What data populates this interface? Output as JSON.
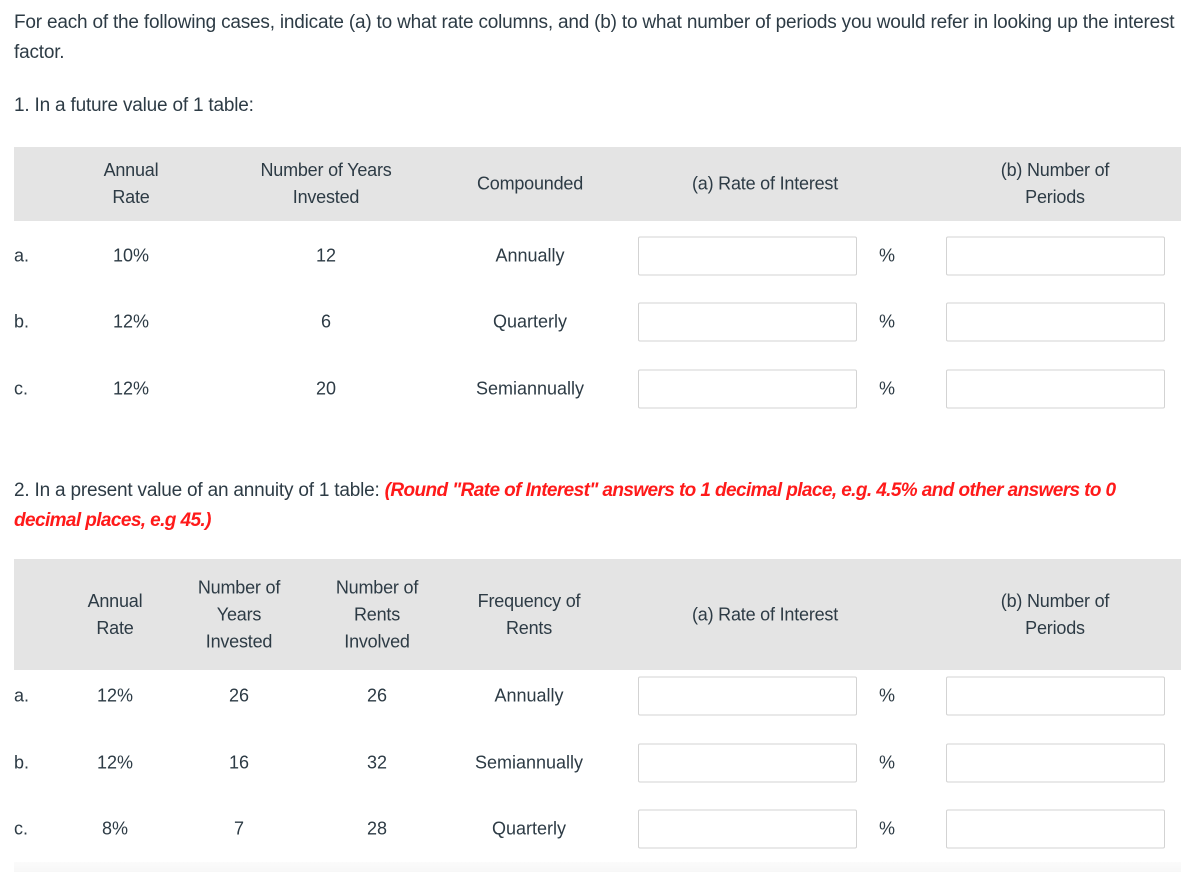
{
  "instructions": "For each of the following cases, indicate (a) to what rate columns, and (b) to what number of periods you would refer in looking up the interest factor.",
  "part1": {
    "title": "1. In a future value of 1 table:",
    "headers": {
      "annual_rate": "Annual\nRate",
      "years": "Number of Years\nInvested",
      "compounded": "Compounded",
      "rate_of_interest": "(a) Rate of Interest",
      "number_of_periods": "(b) Number of Periods"
    },
    "rows": [
      {
        "label": "a.",
        "annual_rate": "10%",
        "years": "12",
        "compounded": "Annually",
        "rate_value": "",
        "unit": "%",
        "periods_value": ""
      },
      {
        "label": "b.",
        "annual_rate": "12%",
        "years": "6",
        "compounded": "Quarterly",
        "rate_value": "",
        "unit": "%",
        "periods_value": ""
      },
      {
        "label": "c.",
        "annual_rate": "12%",
        "years": "20",
        "compounded": "Semiannually",
        "rate_value": "",
        "unit": "%",
        "periods_value": ""
      }
    ]
  },
  "part2": {
    "title": "2. In a present value of an annuity of 1 table: ",
    "note": "(Round \"Rate of Interest\" answers to 1 decimal place, e.g. 4.5% and other answers to 0 decimal places, e.g 45.)",
    "headers": {
      "annual_rate": "Annual\nRate",
      "years": "Number of\nYears\nInvested",
      "rents": "Number of\nRents\nInvolved",
      "frequency": "Frequency of\nRents",
      "rate_of_interest": "(a) Rate of Interest",
      "number_of_periods": "(b) Number of Periods"
    },
    "rows": [
      {
        "label": "a.",
        "annual_rate": "12%",
        "years": "26",
        "rents": "26",
        "frequency": "Annually",
        "rate_value": "",
        "unit": "%",
        "periods_value": ""
      },
      {
        "label": "b.",
        "annual_rate": "12%",
        "years": "16",
        "rents": "32",
        "frequency": "Semiannually",
        "rate_value": "",
        "unit": "%",
        "periods_value": ""
      },
      {
        "label": "c.",
        "annual_rate": "8%",
        "years": "7",
        "rents": "28",
        "frequency": "Quarterly",
        "rate_value": "",
        "unit": "%",
        "periods_value": ""
      }
    ]
  },
  "colors": {
    "text": "#2d3b45",
    "header_bg": "#e4e4e4",
    "note": "#ff1a1a",
    "input_border": "#d3d3d3"
  }
}
